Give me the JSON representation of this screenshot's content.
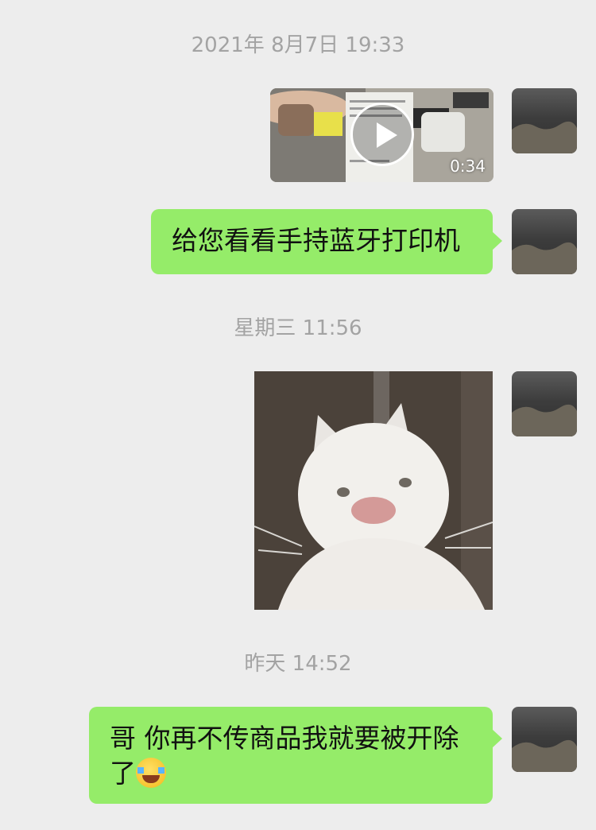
{
  "messages": {
    "ts1": "2021年 8月7日 19:33",
    "video_duration": "0:34",
    "text1": "给您看看手持蓝牙打印机",
    "ts2": "星期三 11:56",
    "ts3": "昨天 14:52",
    "text2": "哥 你再不传商品我就要被开除了"
  },
  "icons": {
    "play": "play-icon",
    "emoji": "crying-laughing-emoji"
  },
  "colors": {
    "background": "#ededed",
    "bubble": "#95ec69",
    "timestamp": "#a3a3a3"
  }
}
